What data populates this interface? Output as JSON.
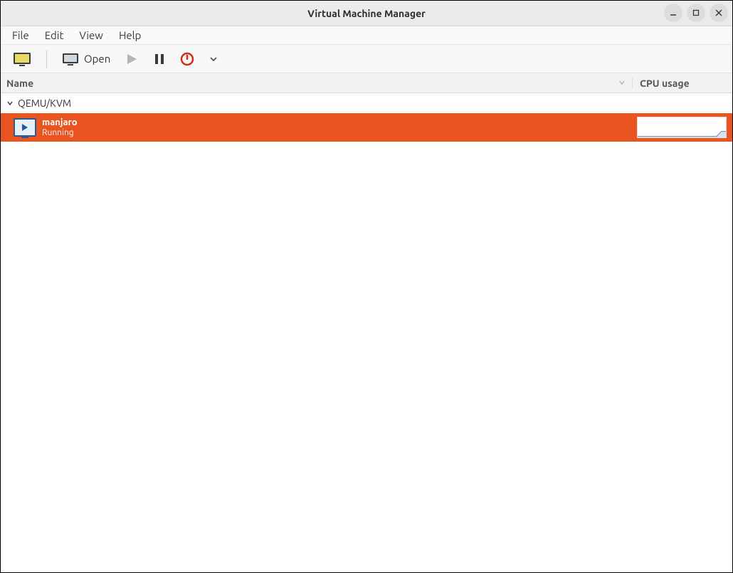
{
  "window": {
    "title": "Virtual Machine Manager"
  },
  "menu": {
    "file": "File",
    "edit": "Edit",
    "view": "View",
    "help": "Help"
  },
  "toolbar": {
    "open_label": "Open"
  },
  "columns": {
    "name": "Name",
    "cpu": "CPU usage"
  },
  "connections": [
    {
      "label": "QEMU/KVM"
    }
  ],
  "vms": [
    {
      "name": "manjaro",
      "status": "Running"
    }
  ],
  "colors": {
    "selection": "#E95420",
    "link": "#2b5b8c",
    "power": "#cf2c1f"
  },
  "chart_data": {
    "type": "line",
    "title": "CPU usage (per-VM sparkline)",
    "xlabel": "",
    "ylabel": "",
    "ylim": [
      0,
      100
    ],
    "series": [
      {
        "name": "manjaro",
        "values": [
          5,
          5,
          5,
          5,
          5,
          5,
          5,
          5,
          5,
          5,
          5,
          5,
          5,
          5,
          5,
          5,
          5,
          5,
          30,
          30
        ]
      }
    ]
  }
}
